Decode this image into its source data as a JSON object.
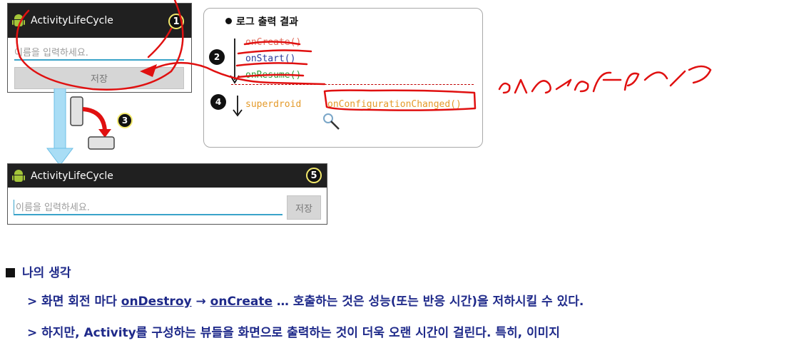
{
  "top_phone": {
    "title": "ActivityLifeCycle",
    "badge": "1",
    "input_placeholder": "이름을 입력하세요.",
    "save_label": "저장"
  },
  "bottom_phone": {
    "title": "ActivityLifeCycle",
    "badge": "5",
    "input_placeholder": "이름을 입력하세요.",
    "save_label": "저장"
  },
  "rotation_badge": "3",
  "log_panel": {
    "heading": "로그 출력 결과",
    "step2_badge": "2",
    "step4_badge": "4",
    "oncreate": "onCreate()",
    "onstart": "onStart()",
    "onresume": "onResume()",
    "tag": "superdroid",
    "config_changed": "onConfigurationChanged()"
  },
  "colors": {
    "accent_blue": "#1f2a8a",
    "log_red": "#e07060",
    "log_blue": "#2b3b9c",
    "log_green": "#2e9e3a",
    "log_orange": "#e49a2a",
    "ink_red": "#e01010"
  },
  "notes": {
    "title": "나의 생각",
    "line1_prefix": "> 화면 회전 마다 ",
    "line1_ondestroy": "onDestroy",
    "line1_arrow": " → ",
    "line1_oncreate": "onCreate",
    "line1_suffix": " … 호출하는 것은 성능(또는 반응 시간)을 저하시킬 수 있다.",
    "line2": "> 하지만, Activity를 구성하는 뷰들을 화면으로 출력하는 것이 더욱 오랜 시간이 걸린다. 특히, 이미지"
  }
}
